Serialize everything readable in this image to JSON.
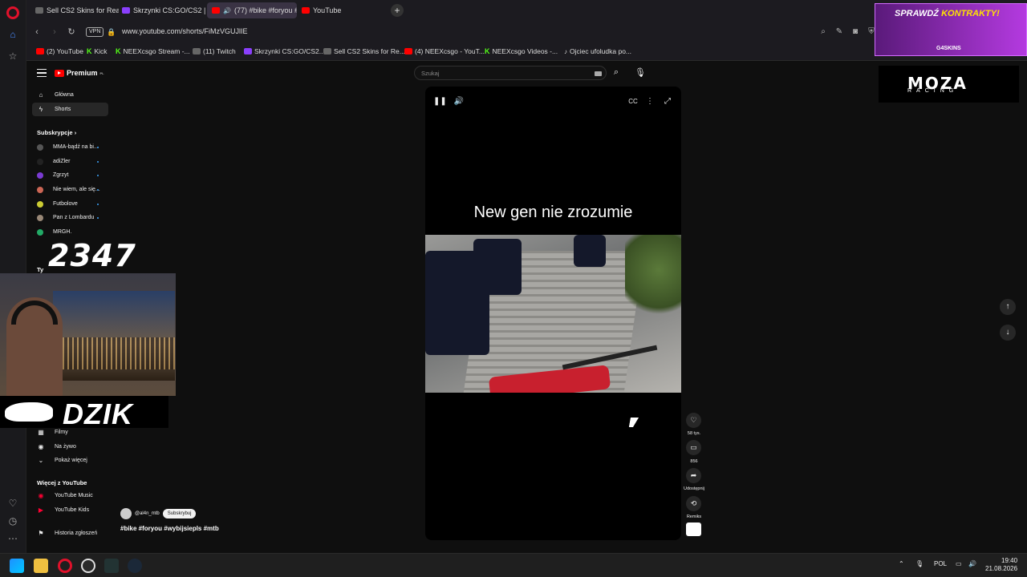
{
  "browser": {
    "tabs": [
      {
        "label": "Sell CS2 Skins for Real Mo",
        "icon": "skins-favicon"
      },
      {
        "label": "Skrzynki CS:GO/CS2 | G4S",
        "icon": "g4skins-favicon"
      },
      {
        "label": "(77) #bike #foryou #w",
        "icon": "youtube-favicon"
      },
      {
        "label": "YouTube",
        "icon": "youtube-favicon"
      }
    ],
    "url": "www.youtube.com/shorts/FiMzVGUJlIE",
    "vpn_label": "VPN",
    "bookmarks": [
      "(2) YouTube",
      "Kick",
      "NEEXcsgo Stream -...",
      "(11) Twitch",
      "Skrzynki CS:GO/CS2...",
      "Sell CS2 Skins for Re...",
      "(4) NEEXcsgo - YouT...",
      "NEEXcsgo Videos -...",
      "Ojciec ufoludka po..."
    ]
  },
  "youtube": {
    "logo": "Premium",
    "logo_suffix": "PL",
    "search_placeholder": "Szukaj",
    "sidebar": {
      "home": "Główna",
      "shorts": "Shorts",
      "subs_header": "Subskrypcje",
      "subs": [
        "MMA-bądź na bi...",
        "adiZler",
        "Zgrzyt",
        "Nie wiem, ale się...",
        "Futbolove",
        "Pan z Lombardu",
        "MRGH."
      ],
      "you_header": "Ty",
      "explore": [
        "Filmy",
        "Na żywo",
        "Pokaż więcej"
      ],
      "more_header": "Więcej z YouTube",
      "more": [
        "YouTube Music",
        "YouTube Kids"
      ],
      "report": "Historia zgłoszeń"
    },
    "video": {
      "caption": "New gen nie zrozumie",
      "channel": "@al4n_mtb",
      "subscribe": "Subskrybuj",
      "tags": "#bike #foryou #wybijsiepls #mtb"
    },
    "actions": {
      "likes": "58 tys.",
      "comments": "856",
      "share": "Udostępnij",
      "remix": "Remiks"
    }
  },
  "overlay": {
    "counter": "2347",
    "brand": "DZIK"
  },
  "ads": {
    "top_title_a": "SPRAWDŹ",
    "top_title_b": "KONTRAKTY!",
    "top_brand": "G4SKINS",
    "right_brand": "MOZA",
    "right_sub": "RACING"
  },
  "taskbar": {
    "lang": "POL",
    "time": "19:40",
    "date": "21.08.2026"
  }
}
